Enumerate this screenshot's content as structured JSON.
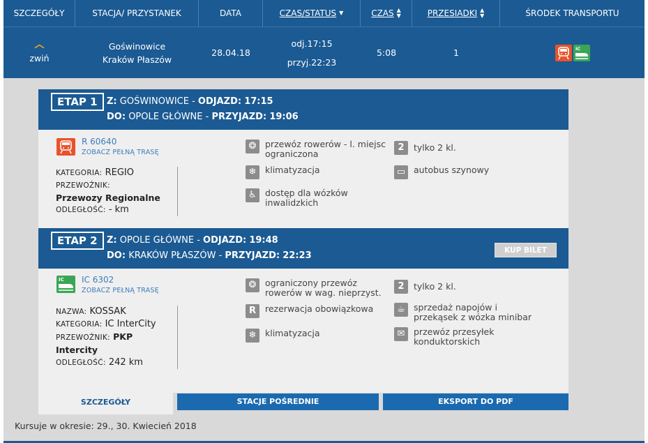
{
  "header": {
    "columns": [
      "SZCZEGÓŁY",
      "STACJA/ PRZYSTANEK",
      "DATA",
      "CZAS/STATUS",
      "CZAS",
      "PRZESIADKI",
      "ŚRODEK TRANSPORTU"
    ]
  },
  "summary": {
    "toggle_label": "zwiń",
    "station_from": "Gośw->nowice",
    "station_from_fixed": "Goświnowice",
    "station_to": "Kraków Płaszów",
    "date": "28.04.18",
    "departure": "odj.17:15",
    "arrival": "przyj.22:23",
    "duration": "5:08",
    "transfers": "1"
  },
  "stages": [
    {
      "label": "ETAP 1",
      "from_prefix": "Z:",
      "from_station": "GOŚWINOWICE",
      "dep_label": "ODJAZD:",
      "dep_time": "17:15",
      "to_prefix": "DO:",
      "to_station": "OPOLE GŁÓWNE",
      "arr_label": "PRZYJAZD:",
      "arr_time": "19:06",
      "train_number": "R 60640",
      "route_link": "ZOBACZ PEŁNĄ TRASĘ",
      "category_label": "KATEGORIA:",
      "category": "REGIO",
      "carrier_label": "PRZEWOŹNIK:",
      "carrier": "Przewozy Regionalne",
      "distance_label": "ODLEGŁOŚĆ:",
      "distance": "- km",
      "features": [
        {
          "icon": "bike-icon",
          "glyph": "❂",
          "text": "przewóz rowerów - l. miejsc ograniczona"
        },
        {
          "icon": "snowflake-icon",
          "glyph": "❄",
          "text": "klimatyzacja"
        },
        {
          "icon": "wheelchair-icon",
          "glyph": "♿",
          "text": "dostęp dla wózków inwalidzkich"
        },
        {
          "icon": "second-class-icon",
          "glyph": "2",
          "text": "tylko 2 kl."
        },
        {
          "icon": "railbus-icon",
          "glyph": "▭",
          "text": "autobus szynowy"
        }
      ]
    },
    {
      "label": "ETAP 2",
      "from_prefix": "Z:",
      "from_station": "OPOLE GŁÓWNE",
      "dep_label": "ODJAZD:",
      "dep_time": "19:48",
      "to_prefix": "DO:",
      "to_station": "KRAKÓW PŁASZÓW",
      "arr_label": "PRZYJAZD:",
      "arr_time": "22:23",
      "buy_label": "KUP BILET",
      "train_number": "IC 6302",
      "route_link": "ZOBACZ PEŁNĄ TRASĘ",
      "name_label": "NAZWA:",
      "name": "KOSSAK",
      "category_label": "KATEGORIA:",
      "category": "IC InterCity",
      "carrier_label": "PRZEWOŹNIK:",
      "carrier": "PKP Intercity",
      "distance_label": "ODLEGŁOŚĆ:",
      "distance": "242 km",
      "features": [
        {
          "icon": "bike-icon",
          "glyph": "❂",
          "text": "ograniczony przewóz rowerów w wag. nieprzyst."
        },
        {
          "icon": "reservation-icon",
          "glyph": "R",
          "text": "rezerwacja obowiązkowa"
        },
        {
          "icon": "snowflake-icon",
          "glyph": "❄",
          "text": "klimatyzacja"
        },
        {
          "icon": "second-class-icon",
          "glyph": "2",
          "text": "tylko 2 kl."
        },
        {
          "icon": "minibar-icon",
          "glyph": "☕",
          "text": "sprzedaż napojów i przekąsek z wózka minibar"
        },
        {
          "icon": "envelope-icon",
          "glyph": "✉",
          "text": "przewóz przesyłek konduktorskich"
        }
      ]
    }
  ],
  "tabs": [
    "SZCZEGÓŁY",
    "STACJE POŚREDNIE",
    "EKSPORT DO PDF"
  ],
  "footer": {
    "operating_period": "Kursuje w okresie: 29., 30. Kwiecień 2018"
  },
  "colors": {
    "primary": "#1b5a93",
    "accent_orange": "#f5a623",
    "regio_red": "#e8532b",
    "ic_green": "#3aa655",
    "link_blue": "#3e7bbd"
  }
}
